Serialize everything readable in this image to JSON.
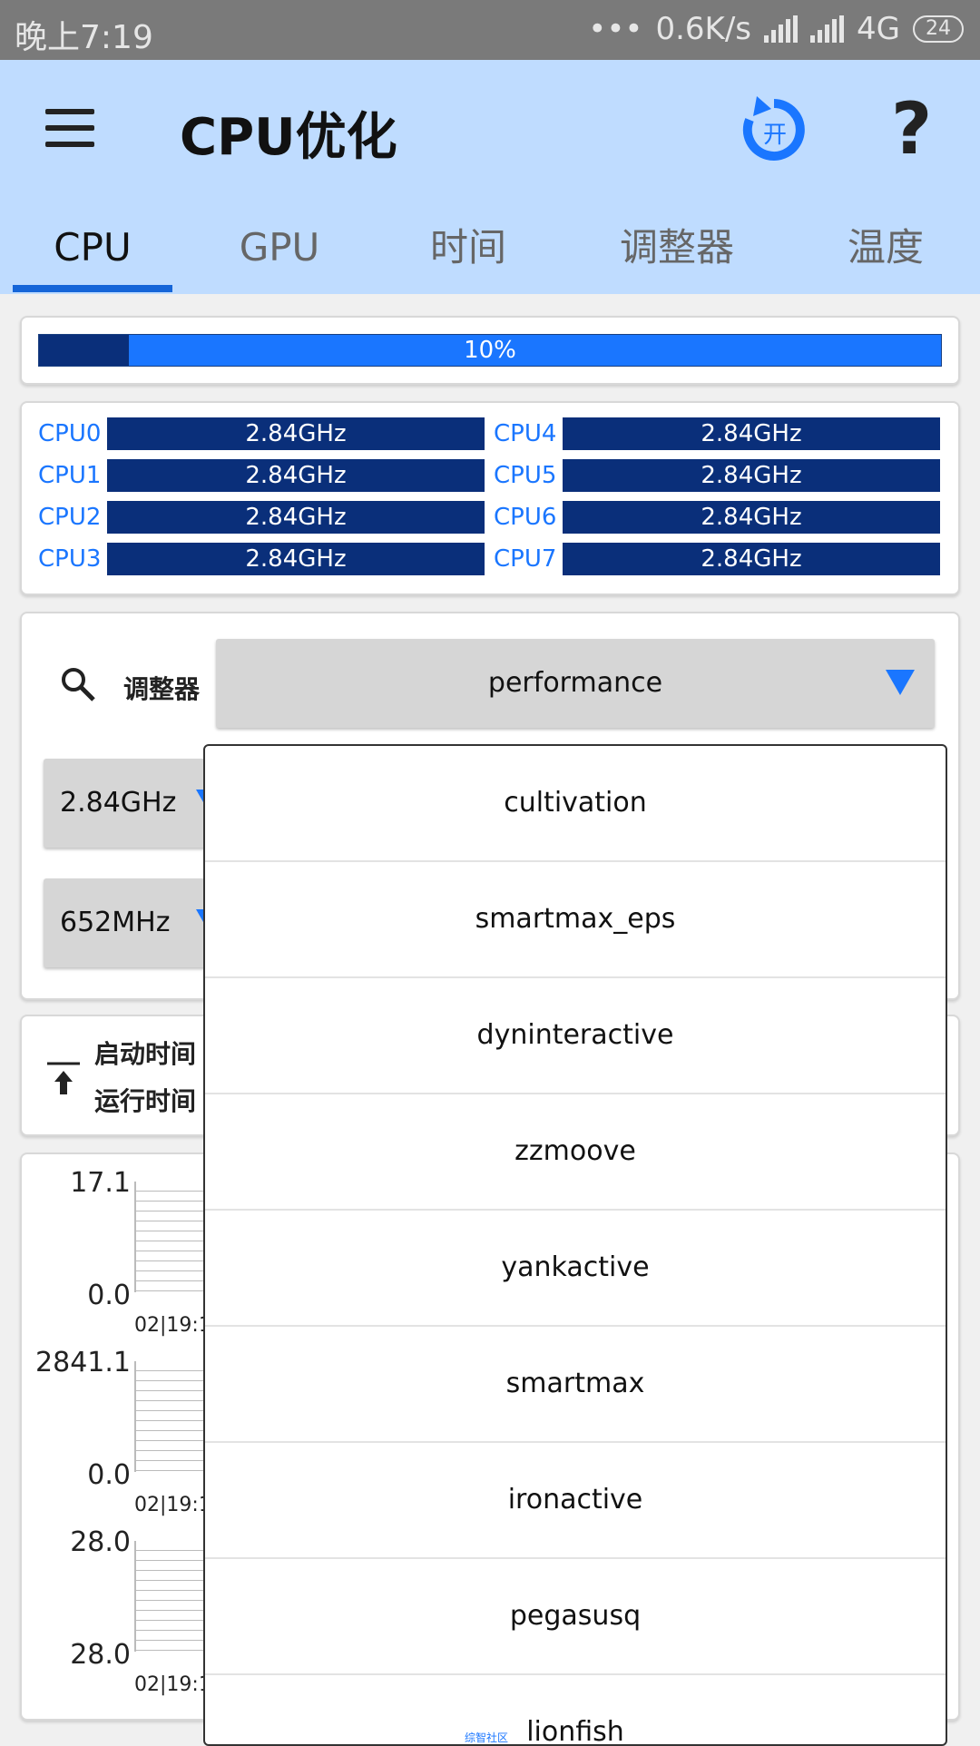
{
  "status_bar": {
    "time": "晚上7:19",
    "dots": "•••",
    "speed": "0.6K/s",
    "network": "4G",
    "battery": "24"
  },
  "app_bar": {
    "title": "CPU优化",
    "refresh_badge": "开",
    "help": "?",
    "tabs": [
      {
        "label": "CPU",
        "active": true
      },
      {
        "label": "GPU"
      },
      {
        "label": "时间"
      },
      {
        "label": "调整器"
      },
      {
        "label": "温度"
      }
    ]
  },
  "load": {
    "percent_label": "10%",
    "fill_fraction": 0.1
  },
  "cpus": [
    {
      "name": "CPU0",
      "freq": "2.84GHz"
    },
    {
      "name": "CPU1",
      "freq": "2.84GHz"
    },
    {
      "name": "CPU2",
      "freq": "2.84GHz"
    },
    {
      "name": "CPU3",
      "freq": "2.84GHz"
    },
    {
      "name": "CPU4",
      "freq": "2.84GHz"
    },
    {
      "name": "CPU5",
      "freq": "2.84GHz"
    },
    {
      "name": "CPU6",
      "freq": "2.84GHz"
    },
    {
      "name": "CPU7",
      "freq": "2.84GHz"
    }
  ],
  "governor": {
    "label": "调整器",
    "selected": "performance",
    "max_freq": "2.84GHz",
    "min_freq": "652MHz"
  },
  "times": {
    "boot_label": "启动时间",
    "run_label": "运行时间"
  },
  "graphs": [
    {
      "y_max": "17.1",
      "y_min": "0.0",
      "x_label": "02|19:1"
    },
    {
      "y_max": "2841.1",
      "y_min": "0.0",
      "x_label": "02|19:1"
    },
    {
      "y_max": "28.0",
      "y_min": "28.0",
      "x_label": "02|19:1"
    }
  ],
  "dropdown_options": [
    "cultivation",
    "smartmax_eps",
    "dyninteractive",
    "zzmoove",
    "yankactive",
    "smartmax",
    "ironactive",
    "pegasusq",
    "lionfish"
  ],
  "watermark": "综智社区",
  "colors": {
    "accent": "#1a76ff",
    "bar_dark": "#0a2f7a",
    "appbar": "#bfdcff"
  }
}
